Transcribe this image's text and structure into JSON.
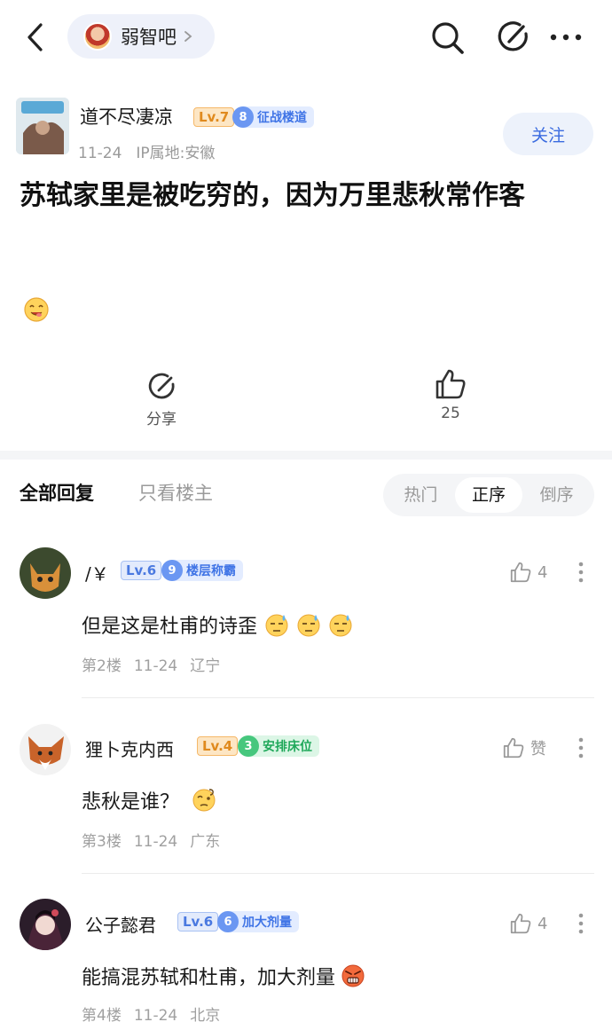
{
  "header": {
    "forum_name": "弱智吧"
  },
  "post": {
    "author": {
      "name": "道不尽凄凉",
      "level": "Lv.7",
      "title_num": "8",
      "title": "征战楼道",
      "date": "11-24",
      "ip": "IP属地:安徽"
    },
    "follow_label": "关注",
    "title": "苏轼家里是被吃穷的，因为万里悲秋常作客",
    "share_label": "分享",
    "like_count": "25"
  },
  "replies": {
    "tab_all": "全部回复",
    "tab_owner": "只看楼主",
    "sort": [
      "热门",
      "正序",
      "倒序"
    ],
    "comments": [
      {
        "name": "/￥",
        "level": "Lv.6",
        "title_num": "9",
        "title": "楼层称霸",
        "text": "但是这是杜甫的诗歪",
        "floor": "第2楼",
        "date": "11-24",
        "location": "辽宁",
        "likes": "4"
      },
      {
        "name": "狸卜克内西",
        "level": "Lv.4",
        "title_num": "3",
        "title": "安排床位",
        "text": "悲秋是谁？",
        "floor": "第3楼",
        "date": "11-24",
        "location": "广东",
        "likes": "赞"
      },
      {
        "name": "公子懿君",
        "level": "Lv.6",
        "title_num": "6",
        "title": "加大剂量",
        "text": "能搞混苏轼和杜甫，加大剂量",
        "floor": "第4楼",
        "date": "11-24",
        "location": "北京",
        "likes": "4"
      }
    ]
  },
  "icons": [
    "back-icon",
    "chevron-right-icon",
    "search-icon",
    "edit-icon",
    "more-icon",
    "share-icon",
    "thumbs-up-icon",
    "emoji-icon"
  ]
}
